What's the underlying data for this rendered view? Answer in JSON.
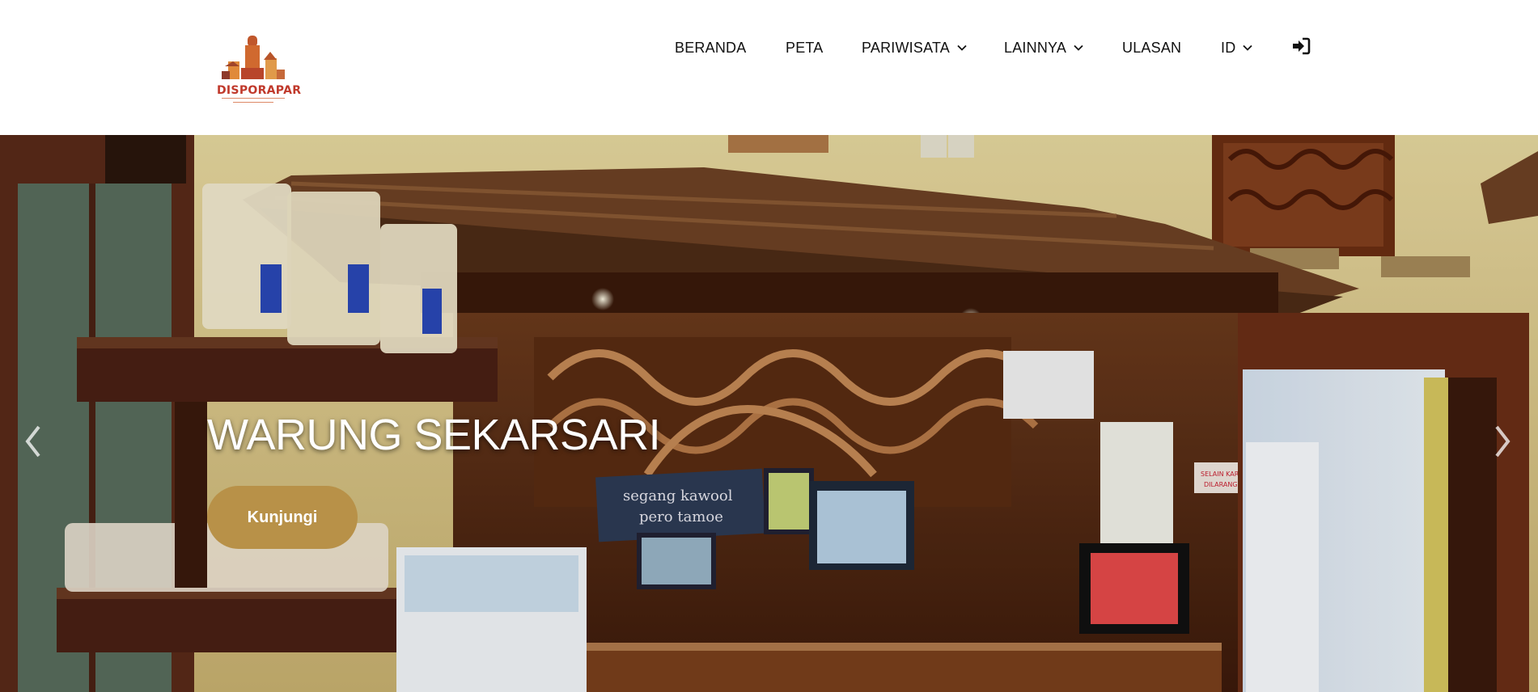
{
  "brand": {
    "logo_text": "DISPORAPAR"
  },
  "nav": {
    "items": [
      {
        "label": "BERANDA",
        "has_dropdown": false
      },
      {
        "label": "PETA",
        "has_dropdown": false
      },
      {
        "label": "PARIWISATA",
        "has_dropdown": true
      },
      {
        "label": "LAINNYA",
        "has_dropdown": true
      },
      {
        "label": "ULASAN",
        "has_dropdown": false
      },
      {
        "label": "ID",
        "has_dropdown": true
      }
    ],
    "login_icon": "sign-in-icon"
  },
  "hero": {
    "title": "WARUNG SEKARSARI",
    "button_label": "Kunjungi",
    "prev_icon": "chevron-left-icon",
    "next_icon": "chevron-right-icon",
    "photo_texts": {
      "chalkboard_line1": "segang kawool",
      "chalkboard_line2": "pero tamoe",
      "sign": "SELAIN KARYAWAN DILARANG MASUK"
    }
  },
  "colors": {
    "button": "#b89148",
    "header_bg": "#ffffff",
    "nav_text": "#111111"
  }
}
